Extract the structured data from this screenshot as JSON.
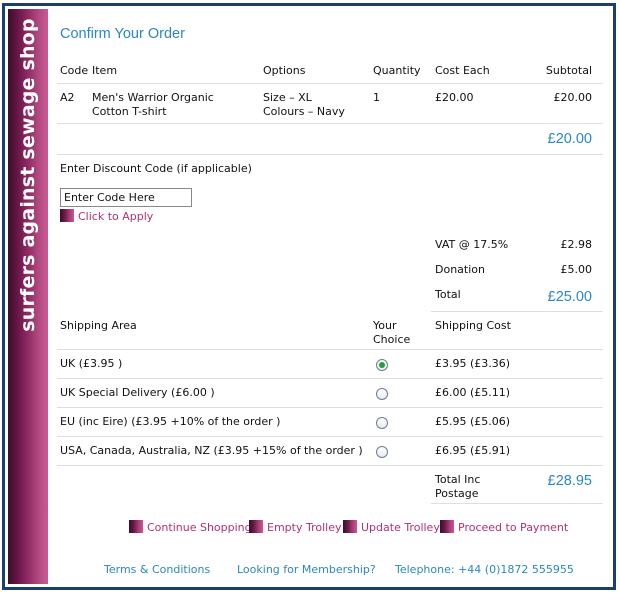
{
  "brand": "surfers against sewage shop",
  "title": "Confirm Your Order",
  "order_table": {
    "headers": [
      "Code",
      "Item",
      "Options",
      "Quantity",
      "Cost Each",
      "Subtotal"
    ],
    "rows": [
      {
        "code": "A2",
        "item": "Men's Warrior Organic Cotton T-shirt",
        "option_size": "Size – XL",
        "option_colour": "Colours – Navy",
        "quantity": "1",
        "cost_each": "£20.00",
        "subtotal": "£20.00"
      }
    ],
    "items_total": "£20.00"
  },
  "discount": {
    "label": "Enter Discount Code (if applicable)",
    "input_value": "Enter Code Here",
    "apply_label": "Click to Apply"
  },
  "totals": {
    "vat_label": "VAT @ 17.5%",
    "vat_value": "£2.98",
    "donation_label": "Donation",
    "donation_value": "£5.00",
    "total_label": "Total",
    "total_value": "£25.00"
  },
  "shipping": {
    "header_area": "Shipping Area",
    "header_choice": "Your Choice",
    "header_cost": "Shipping Cost",
    "options": [
      {
        "area": "UK (£3.95 )",
        "cost": "£3.95 (£3.36)",
        "selected": true
      },
      {
        "area": "UK Special Delivery (£6.00 )",
        "cost": "£6.00 (£5.11)",
        "selected": false
      },
      {
        "area": "EU (inc Eire) (£3.95  +10% of the order )",
        "cost": "£5.95 (£5.06)",
        "selected": false
      },
      {
        "area": "USA, Canada, Australia, NZ (£3.95  +15% of the order )",
        "cost": "£6.95 (£5.91)",
        "selected": false
      }
    ],
    "total_inc_label": "Total Inc Postage",
    "total_inc_value": "£28.95"
  },
  "actions": {
    "continue": "Continue Shopping",
    "empty": "Empty Trolley",
    "update": "Update Trolley",
    "proceed": "Proceed to Payment"
  },
  "footer": {
    "terms": "Terms & Conditions",
    "membership": "Looking for Membership?",
    "telephone": "Telephone: +44 (0)1872 555955"
  },
  "colors": {
    "accent_blue": "#2b88bd",
    "link_pink": "#b0326e",
    "sidebar_purple": "#7a1d56",
    "frame_navy": "#1c3f6b"
  }
}
